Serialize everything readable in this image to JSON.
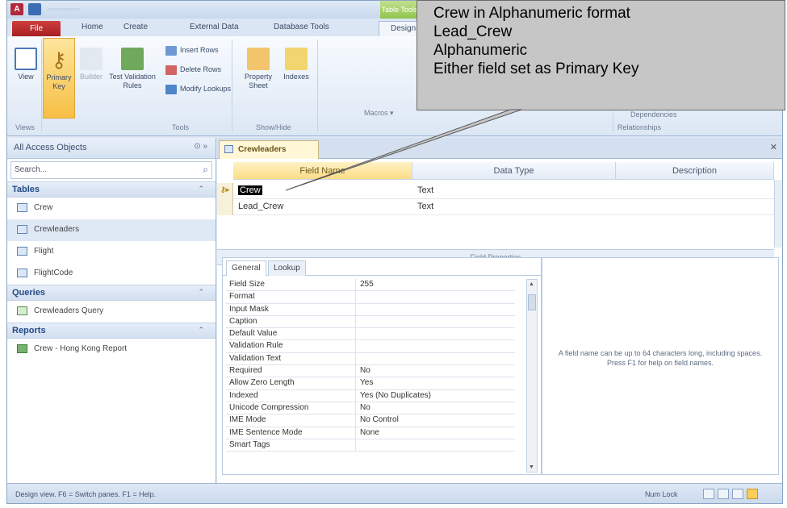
{
  "ribbon": {
    "tabs": [
      "File",
      "Home",
      "Create",
      "External Data",
      "Database Tools",
      "Design"
    ],
    "contextual_tab": "Table Tools",
    "buttons": {
      "view": "View",
      "primary_key": "Primary Key",
      "builder": "Builder",
      "test_validation": "Test Validation Rules",
      "insert_rows": "Insert Rows",
      "delete_rows": "Delete Rows",
      "modify_lookups": "Modify Lookups",
      "property_sheet": "Property Sheet",
      "indexes": "Indexes"
    },
    "macros_label": "Macros ▾",
    "groups": {
      "views": "Views",
      "tools": "Tools",
      "show_hide": "Show/Hide",
      "relationships": "Relationships",
      "dependencies": "Dependencies"
    }
  },
  "nav": {
    "title": "All Access Objects",
    "search_placeholder": "Search...",
    "groups": [
      {
        "label": "Tables",
        "items": [
          "Crew",
          "Crewleaders",
          "Flight",
          "FlightCode"
        ]
      },
      {
        "label": "Queries",
        "items": [
          "Crewleaders Query"
        ]
      },
      {
        "label": "Reports",
        "items": [
          "Crew - Hong Kong Report"
        ]
      }
    ]
  },
  "document": {
    "tab_title": "Crewleaders",
    "columns": {
      "field_name": "Field Name",
      "data_type": "Data Type",
      "description": "Description"
    },
    "rows": [
      {
        "field": "Crew",
        "type": "Text"
      },
      {
        "field": "Lead_Crew",
        "type": "Text"
      }
    ],
    "field_properties_label": "Field Properties"
  },
  "properties": {
    "tabs": [
      "General",
      "Lookup"
    ],
    "rows": [
      {
        "label": "Field Size",
        "value": "255"
      },
      {
        "label": "Format",
        "value": ""
      },
      {
        "label": "Input Mask",
        "value": ""
      },
      {
        "label": "Caption",
        "value": ""
      },
      {
        "label": "Default Value",
        "value": ""
      },
      {
        "label": "Validation Rule",
        "value": ""
      },
      {
        "label": "Validation Text",
        "value": ""
      },
      {
        "label": "Required",
        "value": "No"
      },
      {
        "label": "Allow Zero Length",
        "value": "Yes"
      },
      {
        "label": "Indexed",
        "value": "Yes (No Duplicates)"
      },
      {
        "label": "Unicode Compression",
        "value": "No"
      },
      {
        "label": "IME Mode",
        "value": "No Control"
      },
      {
        "label": "IME Sentence Mode",
        "value": "None"
      },
      {
        "label": "Smart Tags",
        "value": ""
      }
    ],
    "help_text": "A field name can be up to 64 characters long, including spaces. Press F1 for help on field names."
  },
  "status": {
    "text": "Design view.  F6 = Switch panes.  F1 = Help.",
    "num_lock": "Num Lock"
  },
  "callout": {
    "lines": [
      "Crew in Alphanumeric format",
      "Lead_Crew",
      "Alphanumeric",
      "Either field set as Primary Key"
    ]
  }
}
